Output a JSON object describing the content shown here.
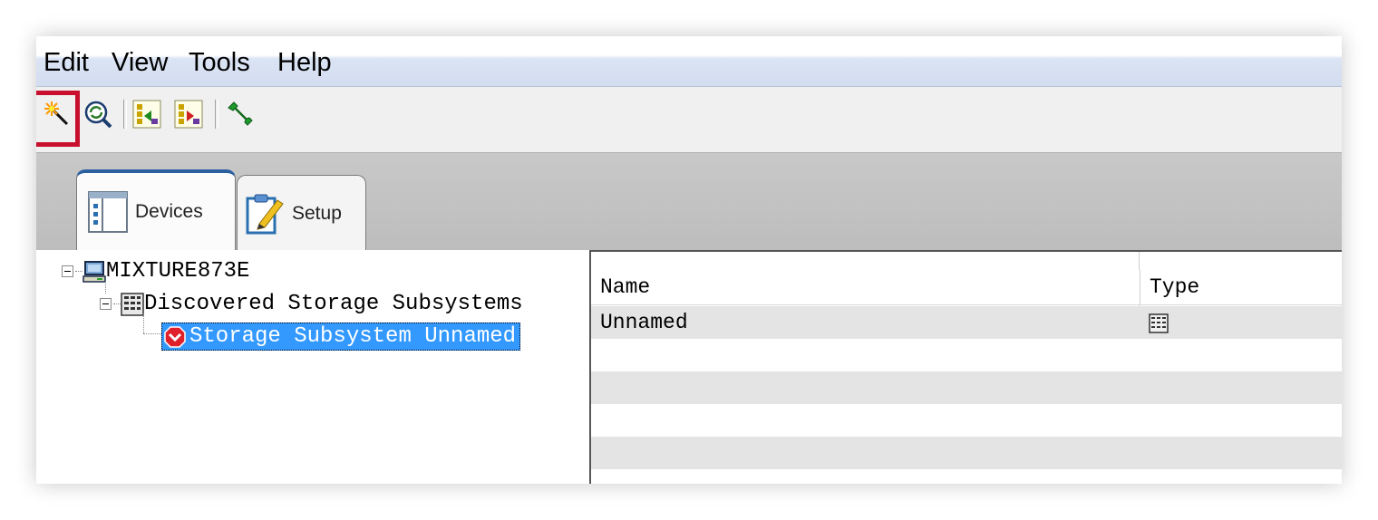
{
  "menubar": {
    "items": [
      "Edit",
      "View",
      "Tools",
      "Help"
    ]
  },
  "toolbar": {
    "buttons": [
      {
        "icon": "new-wizard-icon"
      },
      {
        "icon": "refresh-search-icon"
      },
      {
        "icon": "navigate-back-icon"
      },
      {
        "icon": "navigate-forward-icon"
      },
      {
        "icon": "wrench-icon"
      }
    ],
    "highlight_color": "#c8102e"
  },
  "tabs": [
    {
      "label": "Devices",
      "icon": "devices-icon",
      "active": true
    },
    {
      "label": "Setup",
      "icon": "setup-clipboard-icon",
      "active": false
    }
  ],
  "tree": {
    "host": "MIXTURE873E",
    "group": "Discovered Storage Subsystems",
    "subsystem": "Storage Subsystem Unnamed"
  },
  "grid": {
    "columns": [
      "Name",
      "Type"
    ],
    "rows": [
      {
        "name": "Unnamed",
        "type_icon": "storage-array-icon"
      }
    ]
  },
  "colors": {
    "selection": "#3399ff",
    "status_error": "#e0202a",
    "tab_accent": "#2a5fa0"
  }
}
